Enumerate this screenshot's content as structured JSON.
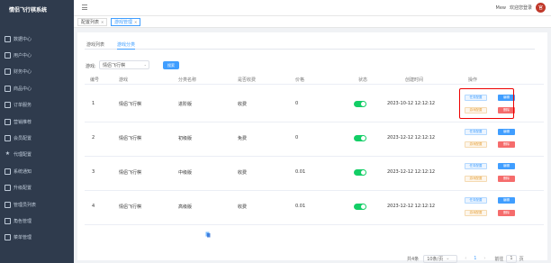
{
  "app": {
    "title": "情侣飞行棋系统"
  },
  "sidebar": {
    "items": [
      {
        "label": "数据中心",
        "icon": "dashboard-icon"
      },
      {
        "label": "用户中心",
        "icon": "user-icon"
      },
      {
        "label": "财务中心",
        "icon": "finance-icon"
      },
      {
        "label": "商品中心",
        "icon": "goods-icon"
      },
      {
        "label": "订单服务",
        "icon": "order-icon"
      },
      {
        "label": "营销推荐",
        "icon": "marketing-icon"
      },
      {
        "label": "会员配置",
        "icon": "member-icon"
      },
      {
        "label": "代理配置",
        "icon": "star-icon"
      },
      {
        "label": "系统通知",
        "icon": "list-icon"
      },
      {
        "label": "升级配置",
        "icon": "list-icon"
      },
      {
        "label": "管理员列表",
        "icon": "admin-icon"
      },
      {
        "label": "角色管理",
        "icon": "role-icon"
      },
      {
        "label": "菜单管理",
        "icon": "menu-icon"
      }
    ]
  },
  "topbar": {
    "user_text": "欢迎您登录",
    "user_name": "Mew",
    "avatar_text": "官"
  },
  "tags": [
    {
      "label": "配置列表"
    },
    {
      "label": "游戏管理"
    }
  ],
  "inner_tabs": [
    {
      "label": "游戏列表"
    },
    {
      "label": "游戏分类"
    }
  ],
  "filter": {
    "label": "游戏:",
    "value": "情侣飞行棋",
    "button": "搜索"
  },
  "table": {
    "headers": [
      "编号",
      "游戏",
      "分类名称",
      "是否收费",
      "价格",
      "状态",
      "创建时间",
      "操作"
    ],
    "rows": [
      {
        "id": "1",
        "game": "情侣飞行棋",
        "category": "进阶版",
        "charge": "收费",
        "price": "0",
        "time": "2023-10-12 12:12:12"
      },
      {
        "id": "2",
        "game": "情侣飞行棋",
        "category": "初级版",
        "charge": "免费",
        "price": "0",
        "time": "2023-12-12 12:12:12"
      },
      {
        "id": "3",
        "game": "情侣飞行棋",
        "category": "中级版",
        "charge": "收费",
        "price": "0.01",
        "time": "2023-12-12 12:12:12"
      },
      {
        "id": "4",
        "game": "情侣飞行棋",
        "category": "高级版",
        "charge": "收费",
        "price": "0.01",
        "time": "2023-12-12 12:12:12"
      }
    ],
    "actions": {
      "config": "任务配置",
      "edit": "编辑",
      "stat": "游戏配置",
      "delete": "删除"
    }
  },
  "pagination": {
    "total": "共4条",
    "page_size": "10条/页",
    "current": "1",
    "goto_label": "前往",
    "goto_value": "1",
    "goto_suffix": "页"
  }
}
